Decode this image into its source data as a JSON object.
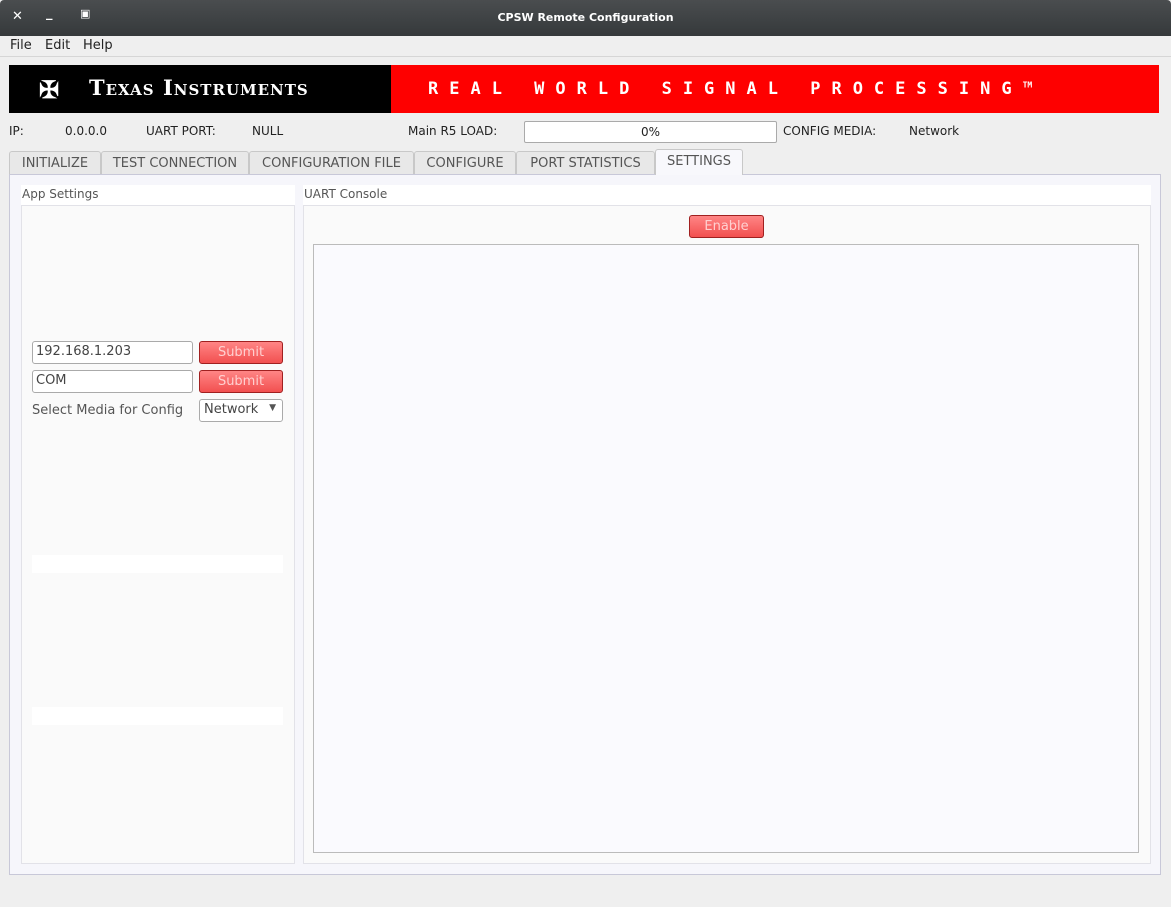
{
  "window": {
    "title": "CPSW Remote Configuration"
  },
  "menu": [
    "File",
    "Edit",
    "Help"
  ],
  "banner": {
    "left": "Texas Instruments",
    "right": "Real World Signal Processing",
    "tm": "TM"
  },
  "info": {
    "ip_label": "IP:",
    "ip_value": "0.0.0.0",
    "uart_label": "UART PORT:",
    "uart_value": "NULL",
    "load_label": "Main R5 LOAD:",
    "load_value": "0%",
    "load_fraction": 0,
    "media_label": "CONFIG MEDIA:",
    "media_value": "Network"
  },
  "tabs": [
    "INITIALIZE",
    "TEST CONNECTION",
    "CONFIGURATION FILE",
    "CONFIGURE",
    "PORT STATISTICS",
    "SETTINGS"
  ],
  "selected_tab": "SETTINGS",
  "app_settings": {
    "title": "App Settings",
    "ip_input": "192.168.1.203",
    "port_input": "COM",
    "submit": "Submit",
    "media_label": "Select Media for Config",
    "media_selected": "Network"
  },
  "uart_console": {
    "title": "UART Console",
    "enable": "Enable",
    "content": ""
  },
  "colors": {
    "accent": "#fe0000",
    "button": "#f25050"
  }
}
